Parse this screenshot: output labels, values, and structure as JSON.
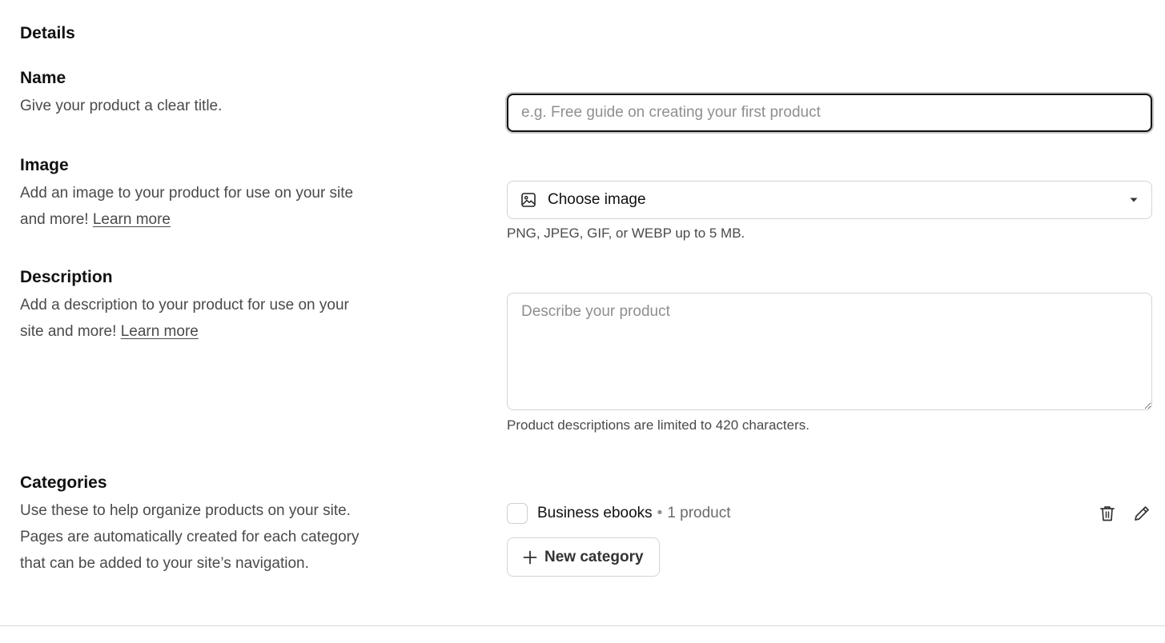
{
  "section": {
    "title": "Details"
  },
  "name": {
    "label": "Name",
    "help": "Give your product a clear title.",
    "placeholder": "e.g. Free guide on creating your first product",
    "value": ""
  },
  "image": {
    "label": "Image",
    "help": "Add an image to your product for use on your site and more!",
    "learn_more": "Learn more",
    "select_label": "Choose image",
    "hint": "PNG, JPEG, GIF, or WEBP up to 5 MB.",
    "icon": "image-icon"
  },
  "description": {
    "label": "Description",
    "help": "Add a description to your product for use on your site and more!",
    "learn_more": "Learn more",
    "placeholder": "Describe your product",
    "value": "",
    "hint": "Product descriptions are limited to 420 characters."
  },
  "categories": {
    "label": "Categories",
    "help": "Use these to help organize products on your site. Pages are automatically created for each category that can be added to your site’s navigation.",
    "items": [
      {
        "name": "Business ebooks",
        "separator": "•",
        "count": "1 product",
        "checked": false
      }
    ],
    "new_button": "New category"
  },
  "colors": {
    "text": "#111111",
    "muted": "#4a4a4a",
    "placeholder": "#8f8f8f",
    "border": "#d4d4d4",
    "focus_border": "#111111"
  }
}
